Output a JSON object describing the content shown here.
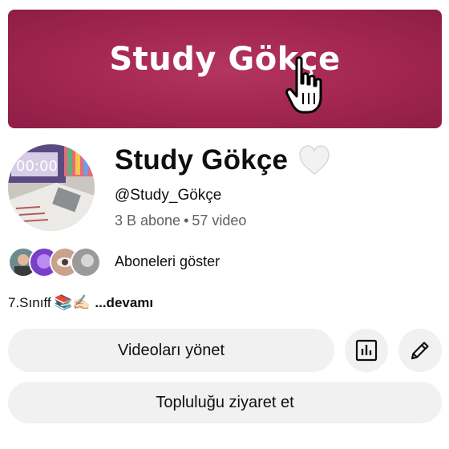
{
  "banner": {
    "text": "Study Gökçe"
  },
  "channel": {
    "name": "Study Gökçe",
    "handle": "@Study_Gökçe",
    "subscribers": "3 B abone",
    "separator": "•",
    "videos": "57 video"
  },
  "subscribers_row": {
    "label": "Aboneleri göster"
  },
  "description": {
    "text": "7.Sınıff",
    "emoji": "📚✍🏻",
    "more": "...devamı"
  },
  "actions": {
    "manage_videos": "Videoları yönet",
    "stats_icon": "bar-chart-icon",
    "edit_icon": "pencil-icon",
    "visit_community": "Topluluğu ziyaret et"
  },
  "colors": {
    "banner": "#a52852",
    "button_bg": "#f1f1f1",
    "secondary_text": "#606060"
  }
}
